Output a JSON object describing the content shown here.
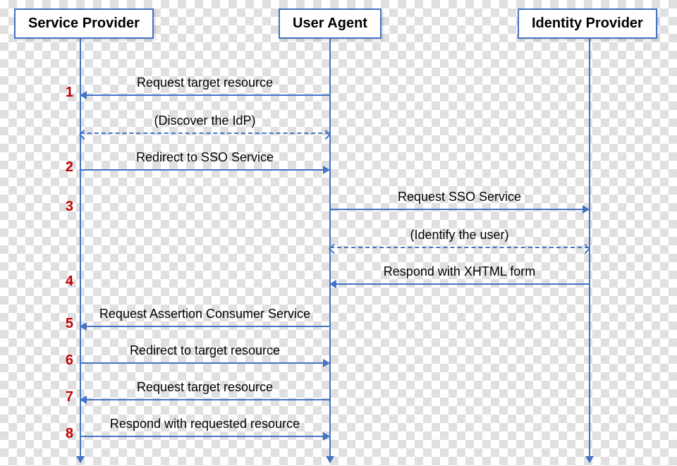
{
  "actors": {
    "sp": "Service Provider",
    "ua": "User Agent",
    "idp": "Identity Provider"
  },
  "messages": {
    "m1": "Request target resource",
    "m_discover": "(Discover the IdP)",
    "m2": "Redirect to SSO Service",
    "m3": "Request SSO Service",
    "m_identify": "(Identify the user)",
    "m4": "Respond with XHTML form",
    "m5": "Request Assertion Consumer Service",
    "m6": "Redirect to target resource",
    "m7": "Request target resource",
    "m8": "Respond with requested resource"
  },
  "steps": {
    "s1": "1",
    "s2": "2",
    "s3": "3",
    "s4": "4",
    "s5": "5",
    "s6": "6",
    "s7": "7",
    "s8": "8"
  }
}
